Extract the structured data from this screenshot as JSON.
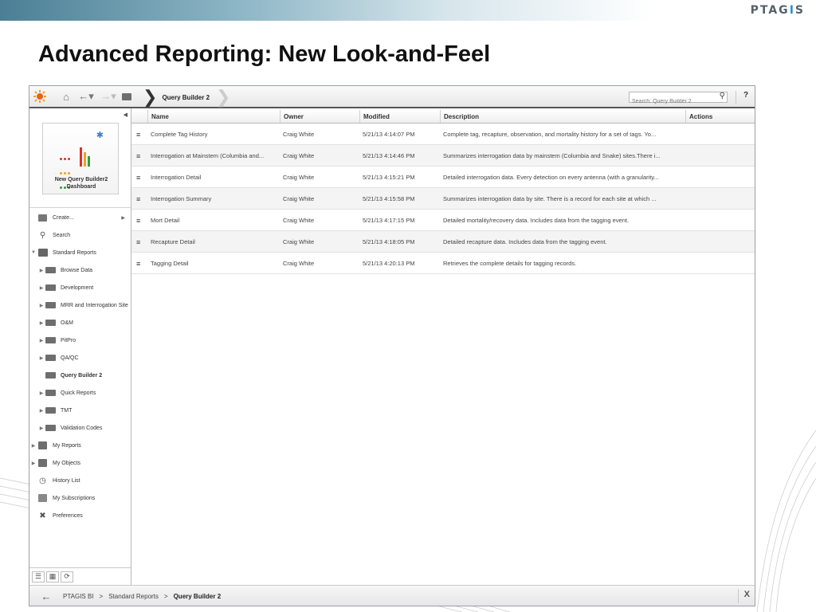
{
  "slide": {
    "brand_prefix": "PTAG",
    "brand_accent": "I",
    "brand_suffix": "S",
    "title": "Advanced Reporting: New Look-and-Feel"
  },
  "toolbar": {
    "active_tab": "Query Builder 2",
    "search_placeholder": "Search: Query Builder 2",
    "help_label": "?"
  },
  "sidebar": {
    "dashboard_caption": "New Query Builder2 Dashboard",
    "items": [
      {
        "label": "Create...",
        "icon": "create-icon"
      },
      {
        "label": "Search",
        "icon": "search-icon"
      },
      {
        "label": "Standard Reports",
        "icon": "reports-icon",
        "expanded": true
      },
      {
        "label": "Browse Data",
        "icon": "folder-icon"
      },
      {
        "label": "Development",
        "icon": "folder-icon"
      },
      {
        "label": "MRR and Interrogation Site",
        "icon": "folder-icon"
      },
      {
        "label": "O&M",
        "icon": "folder-icon"
      },
      {
        "label": "PitPro",
        "icon": "folder-icon"
      },
      {
        "label": "QA/QC",
        "icon": "folder-icon"
      },
      {
        "label": "Query Builder 2",
        "icon": "folder-icon",
        "selected": true
      },
      {
        "label": "Quick Reports",
        "icon": "folder-icon"
      },
      {
        "label": "TMT",
        "icon": "folder-icon"
      },
      {
        "label": "Validation Codes",
        "icon": "folder-icon"
      },
      {
        "label": "My Reports",
        "icon": "my-reports-icon"
      },
      {
        "label": "My Objects",
        "icon": "my-objects-icon"
      },
      {
        "label": "History List",
        "icon": "clock-icon"
      },
      {
        "label": "My Subscriptions",
        "icon": "subscriptions-icon"
      },
      {
        "label": "Preferences",
        "icon": "tools-icon"
      }
    ]
  },
  "table": {
    "columns": [
      "Name",
      "Owner",
      "Modified",
      "Description",
      "Actions"
    ],
    "rows": [
      {
        "name": "Complete Tag History",
        "owner": "Craig White",
        "modified": "5/21/13 4:14:07 PM",
        "description": "Complete tag, recapture, observation, and mortality history for a set of tags. Yo..."
      },
      {
        "name": "Interrogation at Mainstem (Columbia and...",
        "owner": "Craig White",
        "modified": "5/21/13 4:14:46 PM",
        "description": "Summarizes interrogation data by mainstem (Columbia and Snake) sites.There i..."
      },
      {
        "name": "Interrogation Detail",
        "owner": "Craig White",
        "modified": "5/21/13 4:15:21 PM",
        "description": "Detailed interrogation data. Every detection on every antenna (with a granularity..."
      },
      {
        "name": "Interrogation Summary",
        "owner": "Craig White",
        "modified": "5/21/13 4:15:58 PM",
        "description": "Summarizes interrogation data by site. There is a record for each site at which ..."
      },
      {
        "name": "Mort Detail",
        "owner": "Craig White",
        "modified": "5/21/13 4:17:15 PM",
        "description": "Detailed mortality/recovery data. Includes data from the tagging event."
      },
      {
        "name": "Recapture Detail",
        "owner": "Craig White",
        "modified": "5/21/13 4:18:05 PM",
        "description": "Detailed recapture data. Includes data from the tagging event."
      },
      {
        "name": "Tagging Detail",
        "owner": "Craig White",
        "modified": "5/21/13 4:20:13 PM",
        "description": "Retrieves the complete details for tagging records."
      }
    ]
  },
  "statusbar": {
    "crumbs": [
      "PTAGIS BI",
      "Standard Reports",
      "Query Builder 2"
    ],
    "separator": ">",
    "close_label": "X"
  },
  "colors": {
    "accent": "#2a8fd6",
    "toolbar_border": "#555555",
    "row_alt": "#f4f4f4"
  }
}
